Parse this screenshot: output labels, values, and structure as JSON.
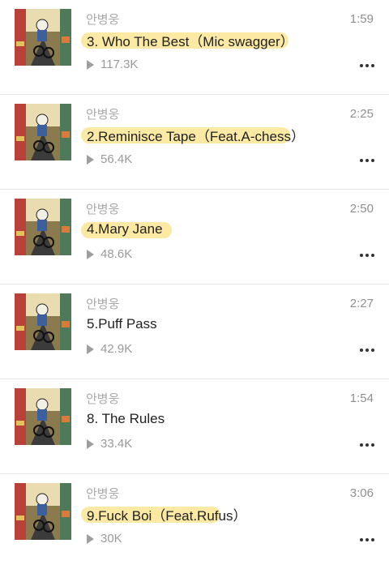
{
  "tracks": [
    {
      "artist": "안병웅",
      "title": "3. Who The Best（Mic swagger）",
      "duration": "1:59",
      "plays": "117.3K",
      "highlighted": true
    },
    {
      "artist": "안병웅",
      "title": "2.Reminisce Tape（Feat.A-chess）",
      "duration": "2:25",
      "plays": "56.4K",
      "highlighted": true
    },
    {
      "artist": "안병웅",
      "title": "4.Mary Jane",
      "duration": "2:50",
      "plays": "48.6K",
      "highlighted": true
    },
    {
      "artist": "안병웅",
      "title": "5.Puff Pass",
      "duration": "2:27",
      "plays": "42.9K",
      "highlighted": false
    },
    {
      "artist": "안병웅",
      "title": "8. The Rules",
      "duration": "1:54",
      "plays": "33.4K",
      "highlighted": false
    },
    {
      "artist": "안병웅",
      "title": "9.Fuck Boi（Feat.Rufus）",
      "duration": "3:06",
      "plays": "30K",
      "highlighted": true
    }
  ],
  "icons": {
    "play": "play-icon",
    "more": "more-icon",
    "cover": "album-cover"
  },
  "colors": {
    "highlight": "#fbe79a",
    "text": "#222222",
    "muted": "#9a9a9a"
  }
}
